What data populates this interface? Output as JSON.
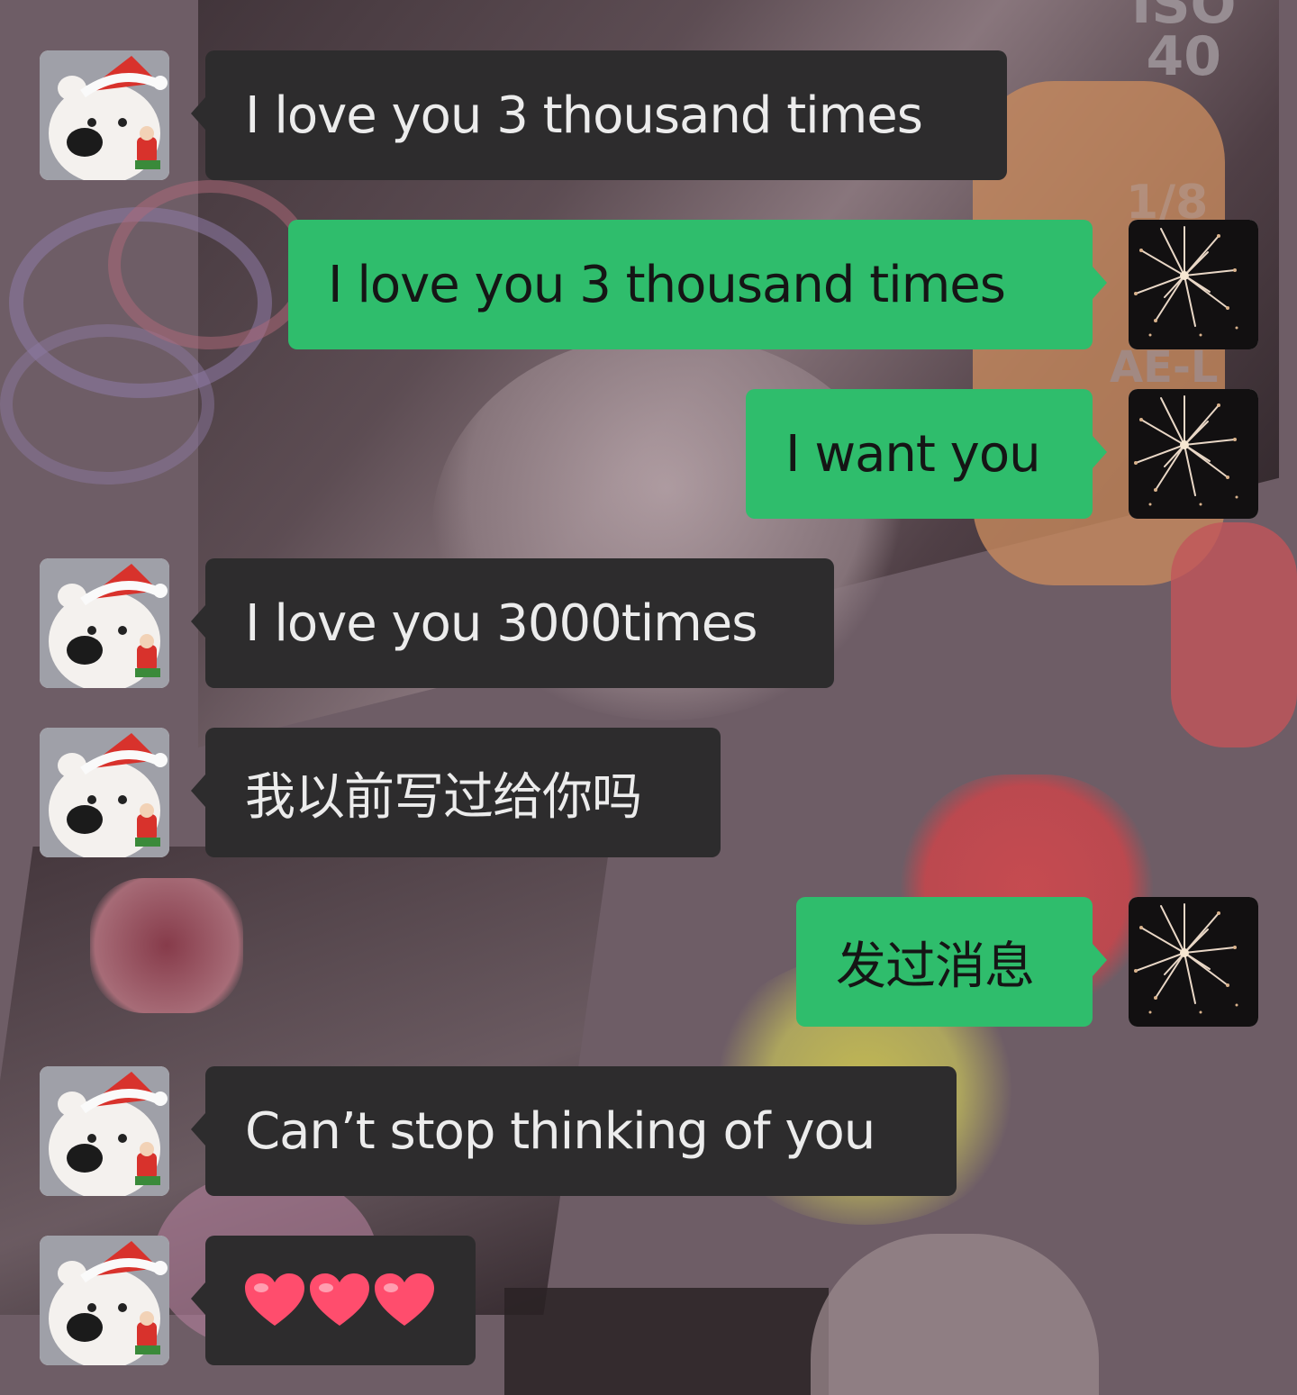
{
  "camera_overlay": {
    "iso_label": "ISO",
    "iso_value": "40",
    "fraction": "1/8",
    "ae_lock": "AE-L"
  },
  "messages": [
    {
      "side": "incoming",
      "avatar": "polar-bear-santa-hat-avatar",
      "text": "I love you 3 thousand times"
    },
    {
      "side": "outgoing",
      "avatar": "fireworks-avatar",
      "text": "I love you 3 thousand times"
    },
    {
      "side": "outgoing",
      "avatar": "fireworks-avatar",
      "text": "I want you"
    },
    {
      "side": "incoming",
      "avatar": "polar-bear-santa-hat-avatar",
      "text": "I love you 3000times"
    },
    {
      "side": "incoming",
      "avatar": "polar-bear-santa-hat-avatar",
      "text": "我以前写过给你吗"
    },
    {
      "side": "outgoing",
      "avatar": "fireworks-avatar",
      "text": "发过消息"
    },
    {
      "side": "incoming",
      "avatar": "polar-bear-santa-hat-avatar",
      "text": "Can’t stop thinking of you"
    },
    {
      "side": "incoming",
      "avatar": "polar-bear-santa-hat-avatar",
      "emoji": [
        "heart-emoji",
        "heart-emoji",
        "heart-emoji"
      ]
    }
  ],
  "colors": {
    "incoming_bubble": "#2d2c2d",
    "outgoing_bubble": "#2fbd6c",
    "incoming_text": "#ececec",
    "outgoing_text": "#151515",
    "heart": "#ff4d6d"
  }
}
